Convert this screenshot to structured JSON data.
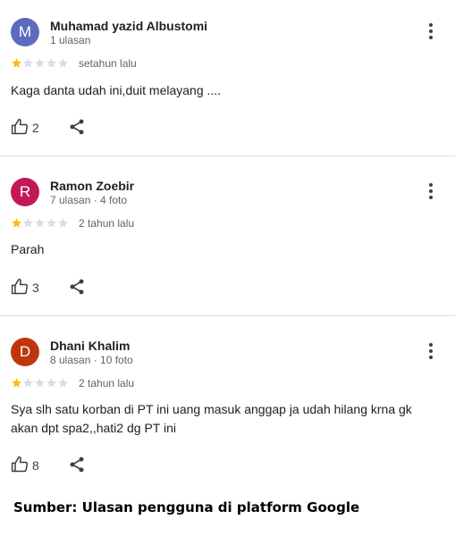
{
  "colors": {
    "star_filled": "#fbbc04",
    "star_empty": "#dadce0",
    "divider": "#dadce0"
  },
  "reviews": [
    {
      "avatar_letter": "M",
      "avatar_color": "#5c6bc0",
      "name": "Muhamad yazid Albustomi",
      "meta": "1 ulasan",
      "rating": 1,
      "max_rating": 5,
      "date": "setahun lalu",
      "text": "Kaga danta udah ini,duit melayang ....",
      "likes": "2"
    },
    {
      "avatar_letter": "R",
      "avatar_color": "#c2185b",
      "name": "Ramon Zoebir",
      "meta": "7 ulasan · 4 foto",
      "rating": 1,
      "max_rating": 5,
      "date": "2 tahun lalu",
      "text": "Parah",
      "likes": "3"
    },
    {
      "avatar_letter": "D",
      "avatar_color": "#bf360c",
      "name": "Dhani Khalim",
      "meta": "8 ulasan · 10 foto",
      "rating": 1,
      "max_rating": 5,
      "date": "2 tahun lalu",
      "text": "Sya slh satu korban di PT ini uang masuk anggap ja udah hilang krna gk akan dpt spa2,,hati2 dg PT ini",
      "likes": "8"
    }
  ],
  "caption": "Sumber: Ulasan pengguna di platform Google"
}
